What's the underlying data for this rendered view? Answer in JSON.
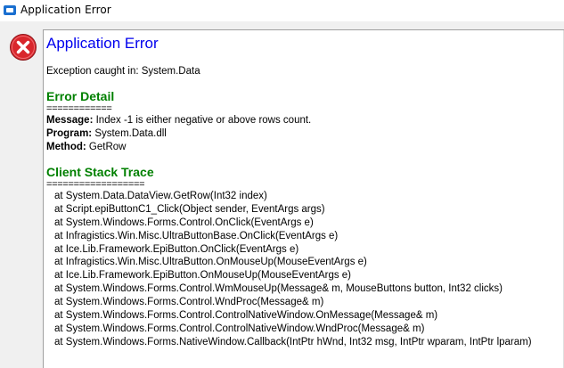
{
  "window": {
    "title": "Application Error",
    "icon": "app-window-icon"
  },
  "dialog": {
    "icon": "error-icon",
    "heading": "Application Error",
    "exception_line": "Exception caught in: System.Data",
    "error_detail": {
      "heading": "Error Detail",
      "separator": "============",
      "message_label": "Message:",
      "message_value": " Index -1 is either negative or above rows count.",
      "program_label": "Program:",
      "program_value": " System.Data.dll",
      "method_label": "Method:",
      "method_value": " GetRow"
    },
    "stack_trace": {
      "heading": "Client Stack Trace",
      "separator": "==================",
      "lines": [
        "at System.Data.DataView.GetRow(Int32 index)",
        "at Script.epiButtonC1_Click(Object sender, EventArgs args)",
        "at System.Windows.Forms.Control.OnClick(EventArgs e)",
        "at Infragistics.Win.Misc.UltraButtonBase.OnClick(EventArgs e)",
        "at Ice.Lib.Framework.EpiButton.OnClick(EventArgs e)",
        "at Infragistics.Win.Misc.UltraButton.OnMouseUp(MouseEventArgs e)",
        "at Ice.Lib.Framework.EpiButton.OnMouseUp(MouseEventArgs e)",
        "at System.Windows.Forms.Control.WmMouseUp(Message& m, MouseButtons button, Int32 clicks)",
        "at System.Windows.Forms.Control.WndProc(Message& m)",
        "at System.Windows.Forms.Control.ControlNativeWindow.OnMessage(Message& m)",
        "at System.Windows.Forms.Control.ControlNativeWindow.WndProc(Message& m)",
        "at System.Windows.Forms.NativeWindow.Callback(IntPtr hWnd, Int32 msg, IntPtr wparam, IntPtr lparam)"
      ]
    }
  },
  "colors": {
    "heading_blue": "#0000ee",
    "section_green": "#008000",
    "error_red": "#d9262c"
  }
}
